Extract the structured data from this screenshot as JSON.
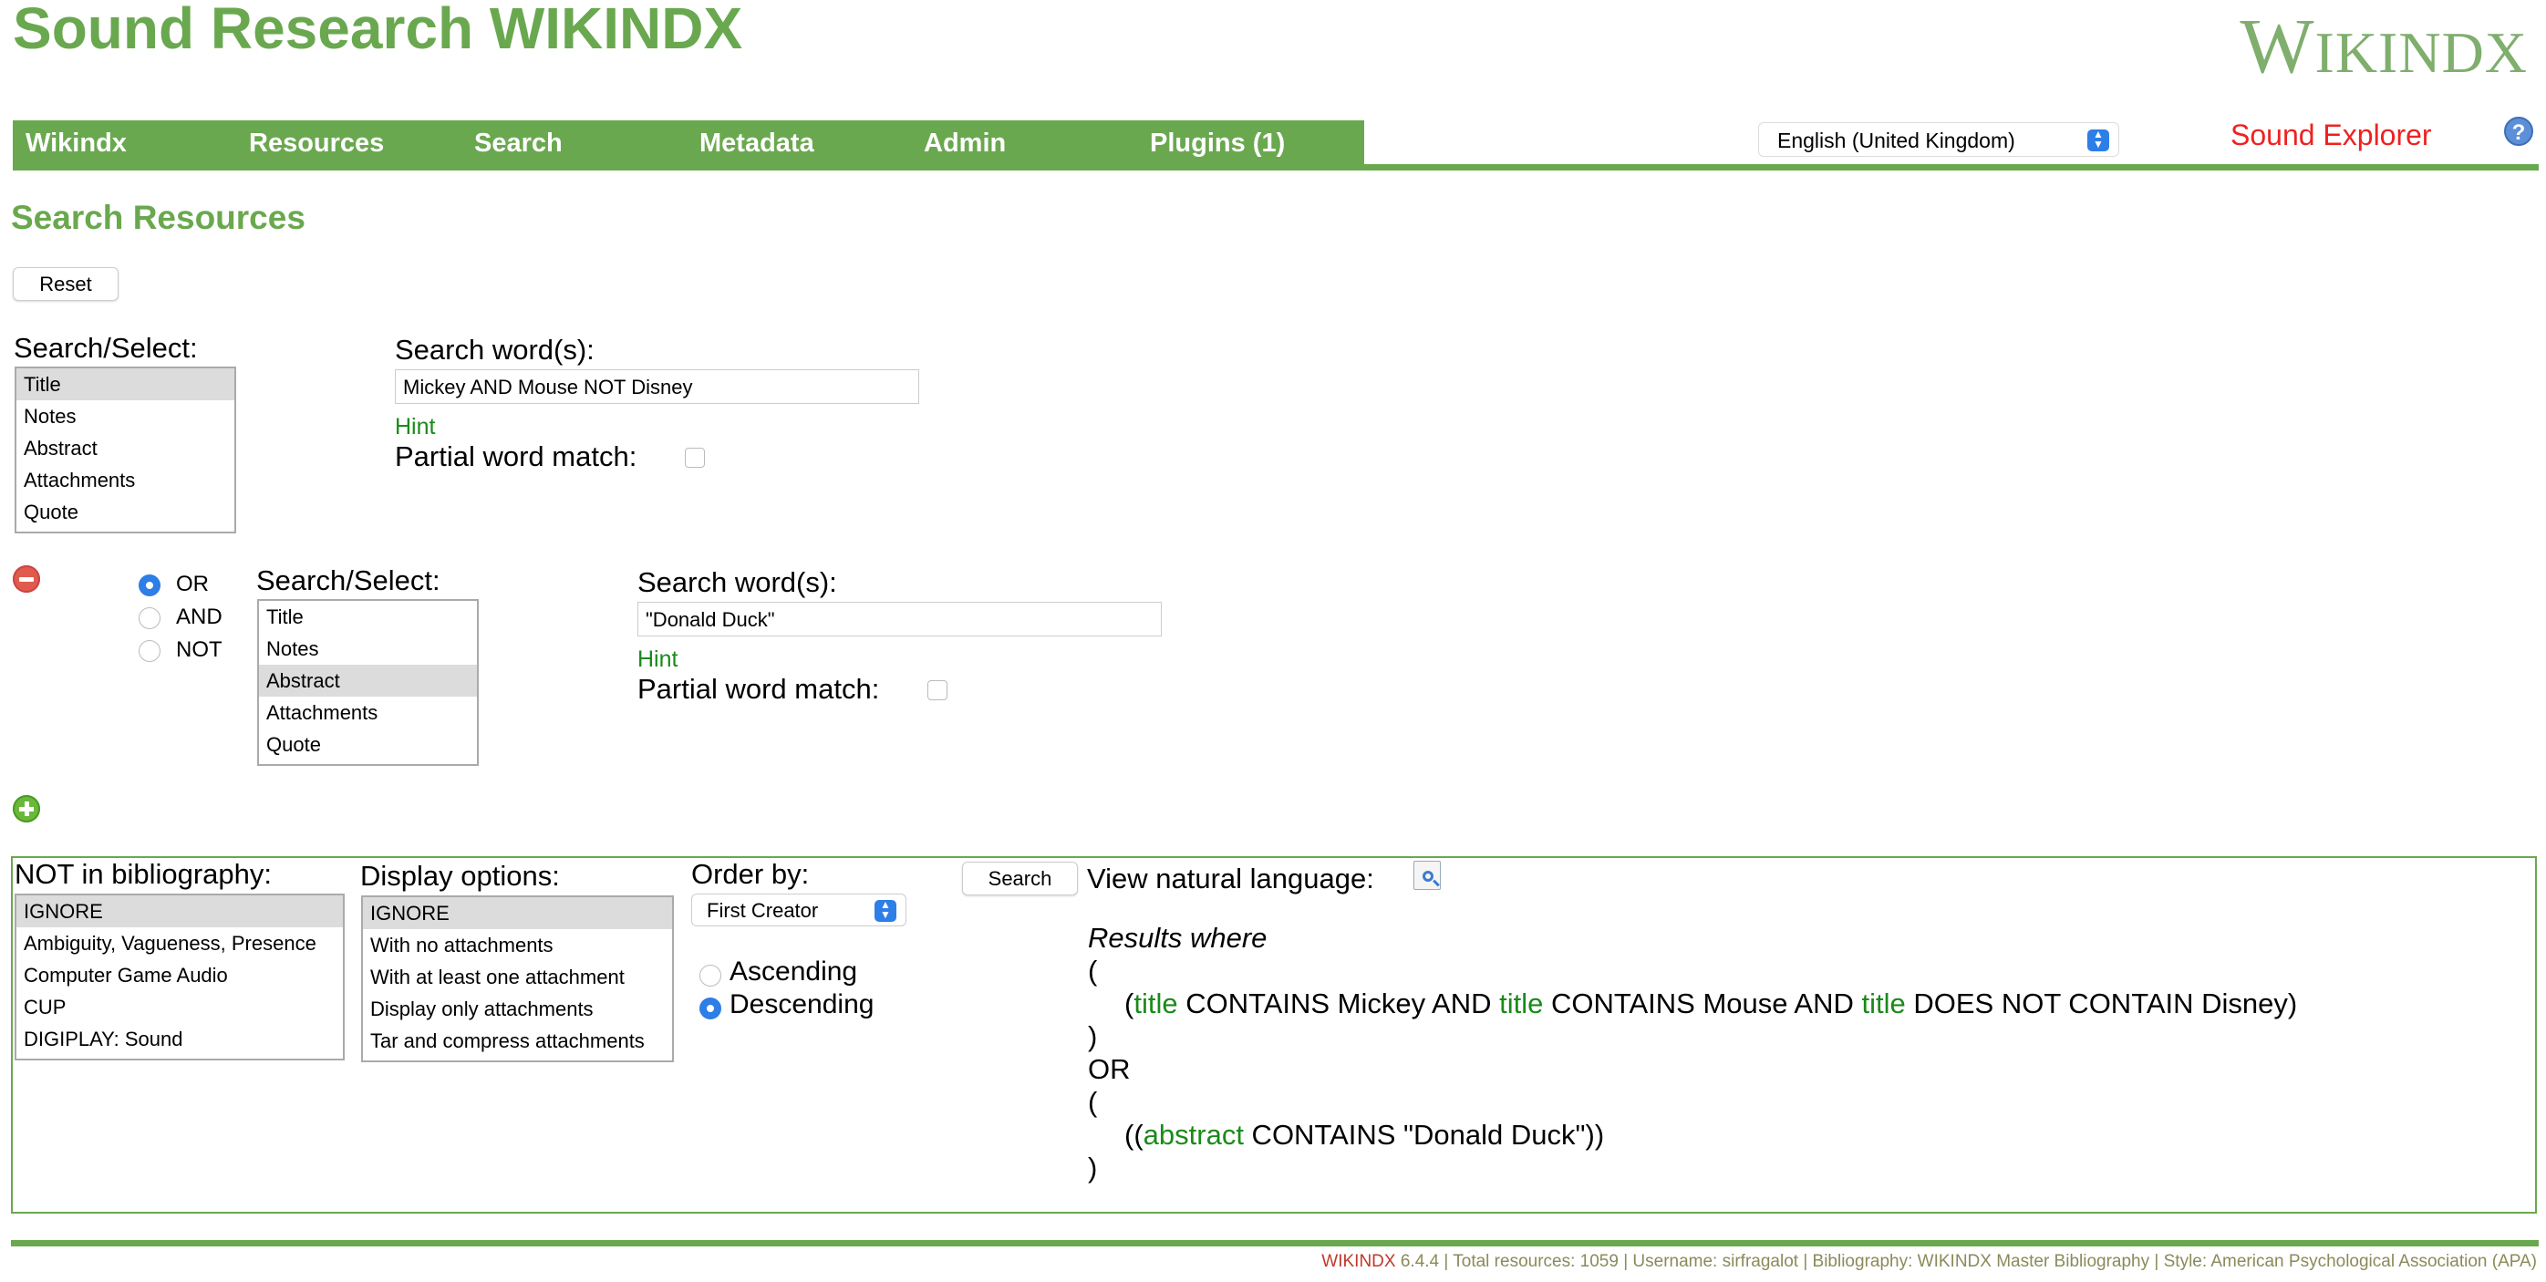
{
  "header": {
    "site_title": "Sound Research WIKINDX",
    "logo": "WIKINDX",
    "logo_first": "W",
    "logo_rest": "IKINDX"
  },
  "nav": {
    "items": [
      "Wikindx",
      "Resources",
      "Search",
      "Metadata",
      "Admin",
      "Plugins (1)"
    ]
  },
  "language_select": {
    "value": "English (United Kingdom)"
  },
  "explorer_link": "Sound Explorer",
  "help_icon": "?",
  "page_title": "Search Resources",
  "reset_button": "Reset",
  "search_block_1": {
    "select_label": "Search/Select:",
    "options": [
      "Title",
      "Notes",
      "Abstract",
      "Attachments",
      "Quote"
    ],
    "selected": "Title",
    "words_label": "Search word(s):",
    "words_value": "Mickey AND Mouse NOT Disney",
    "hint": "Hint",
    "partial_label": "Partial word match:",
    "partial_checked": false
  },
  "search_block_2": {
    "operators": [
      "OR",
      "AND",
      "NOT"
    ],
    "operator_selected": "OR",
    "select_label": "Search/Select:",
    "options": [
      "Title",
      "Notes",
      "Abstract",
      "Attachments",
      "Quote"
    ],
    "selected": "Abstract",
    "words_label": "Search word(s):",
    "words_value": "\"Donald Duck\"",
    "hint": "Hint",
    "partial_label": "Partial word match:",
    "partial_checked": false
  },
  "icons": {
    "remove": "remove-circle-icon",
    "add": "add-circle-icon",
    "natural_language": "magnifier-document-icon",
    "help": "help-icon"
  },
  "options_panel": {
    "not_in_bib_label": "NOT in bibliography:",
    "not_in_bib_options": [
      "IGNORE",
      "Ambiguity, Vagueness, Presence",
      "Computer Game Audio",
      "CUP",
      "DIGIPLAY: Sound"
    ],
    "display_label": "Display options:",
    "display_options": [
      "IGNORE",
      "With no attachments",
      "With at least one attachment",
      "Display only attachments",
      "Tar and compress attachments"
    ],
    "order_label": "Order by:",
    "order_value": "First Creator",
    "ascending": "Ascending",
    "descending": "Descending",
    "direction_selected": "Descending",
    "search_button": "Search",
    "view_nl_label": "View natural language:"
  },
  "natural_language": {
    "results_where": "Results where",
    "open1": "(",
    "line1": {
      "prefix": "(",
      "f1": "title",
      "t1": " CONTAINS Mickey AND ",
      "f2": "title",
      "t2": " CONTAINS Mouse AND ",
      "f3": "title",
      "t3": " DOES NOT CONTAIN Disney)"
    },
    "close1": ")",
    "or": "OR",
    "open2": "(",
    "line2": {
      "prefix": "((",
      "f1": "abstract",
      "t1": " CONTAINS \"Donald Duck\"))"
    },
    "close2": ")"
  },
  "footer": {
    "brand": "WIKINDX",
    "text": " 6.4.4 | Total resources: 1059 | Username: sirfragalot | Bibliography: WIKINDX Master Bibliography | Style: American Psychological Association (APA)"
  },
  "colors": {
    "accent": "#6aa84f",
    "explorer": "#e22222",
    "hint": "#1a8a1a",
    "select_blue": "#2d7ee6"
  }
}
